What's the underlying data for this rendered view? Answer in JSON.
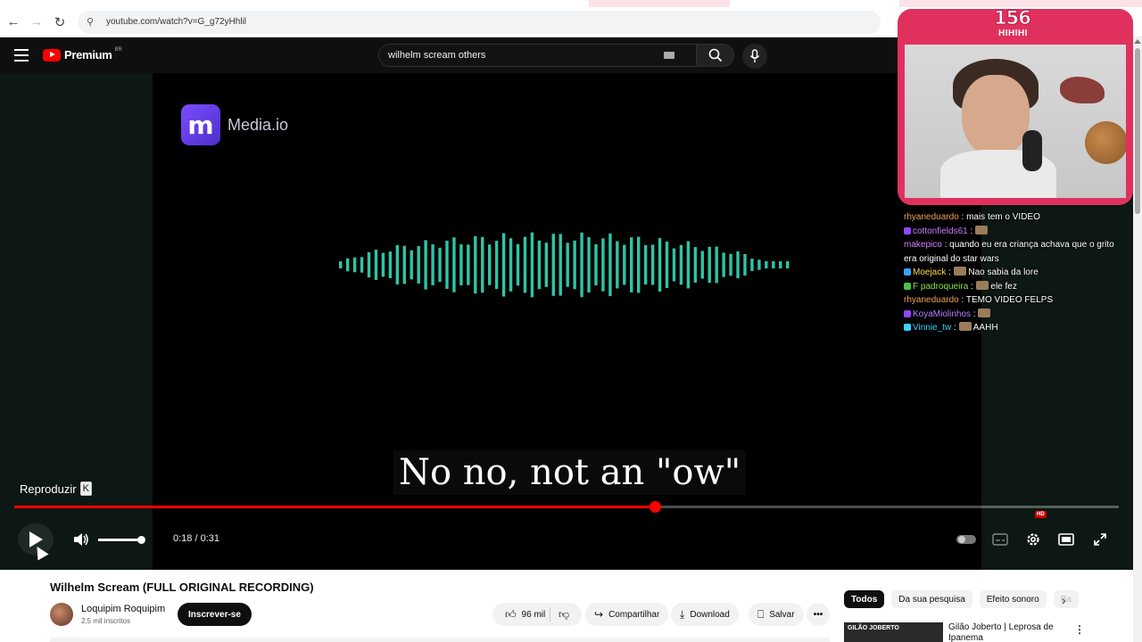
{
  "browser": {
    "url": "youtube.com/watch?v=G_g72yHhlil",
    "back": "←",
    "forward": "→",
    "reload": "↻",
    "site_icon": "⚲"
  },
  "header": {
    "logo_text": "Premium",
    "logo_region": "BR",
    "search_query": "wilhelm scream others"
  },
  "player": {
    "watermark": "Media.io",
    "watermark_letter": "m",
    "subtitle": "No no, not an \"ow\"",
    "tooltip_label": "Reproduzir",
    "tooltip_key": "K",
    "time_display": "0:18 / 0:31",
    "progress_fraction": 0.58,
    "volume_fraction": 1.0,
    "hd_badge": "HD",
    "icons": [
      "play-icon",
      "volume-icon",
      "autoplay-toggle",
      "subtitles-icon",
      "settings-icon",
      "theater-icon",
      "fullscreen-icon"
    ]
  },
  "video": {
    "title": "Wilhelm Scream (FULL ORIGINAL RECORDING)",
    "channel_name": "Loquipim Roquipim",
    "subscribers": "2,5 mil inscritos",
    "subscribe_label": "Inscrever-se",
    "likes": "96 mil",
    "share_label": "Compartilhar",
    "download_label": "Download",
    "save_label": "Salvar",
    "more_label": "•••"
  },
  "sidebar": {
    "chips": [
      "Todos",
      "Da sua pesquisa",
      "Efeito sonoro",
      "Ba"
    ],
    "recommendation_title": "Gilão Joberto | Leprosa de Ipanema",
    "recommendation_thumb_text": "GILÃO JOBERTO"
  },
  "stream_overlay": {
    "viewer_count": "156",
    "viewer_label": "HIHIHI",
    "chat": [
      {
        "user": "rhyaneduardo",
        "color": "#f0a050",
        "message": "mais tem o VIDEO",
        "badge": "",
        "emote": false
      },
      {
        "user": "cottonfields61",
        "color": "#c77dff",
        "message": "",
        "badge": "#9147ff",
        "emote": true
      },
      {
        "user": "makepico",
        "color": "#d080ff",
        "message": "quando eu era criança achava que o grito era original do star wars",
        "badge": "",
        "emote": false
      },
      {
        "user": "Moejack",
        "color": "#ffd94a",
        "message": "Nao sabia da lore",
        "badge": "#3aa0ff",
        "emote": true
      },
      {
        "user": "F padroqueira",
        "color": "#8ae34a",
        "message": "ele fez",
        "badge": "#47c24a",
        "emote": true
      },
      {
        "user": "rhyaneduardo",
        "color": "#f0a050",
        "message": "TEMO VIDEO FELPS",
        "badge": "",
        "emote": false
      },
      {
        "user": "KoyaMiolinhos",
        "color": "#b57dff",
        "message": "",
        "badge": "#9147ff",
        "emote": true
      },
      {
        "user": "Vinnie_tw",
        "color": "#3ad0ff",
        "message": "AAHH",
        "badge": "#3ad0ff",
        "emote": true
      }
    ]
  },
  "colors": {
    "waveform": "#2ec4a6",
    "progress": "#ff0000",
    "overlay_frame": "#e0315e"
  }
}
